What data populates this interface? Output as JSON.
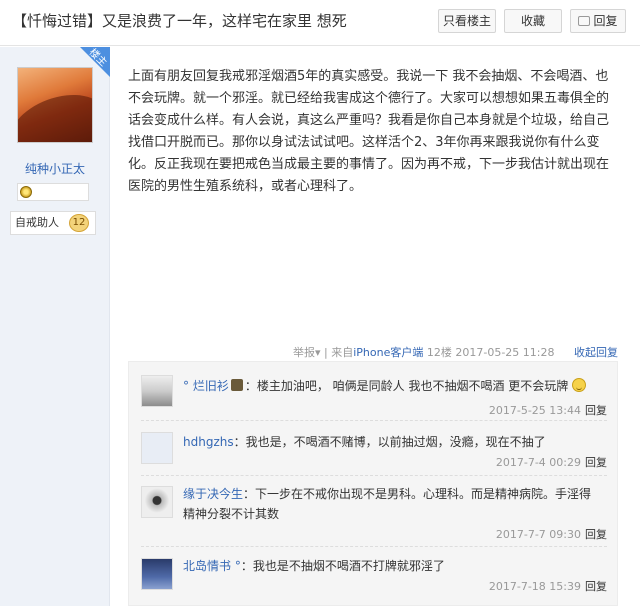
{
  "header": {
    "title": "【忏悔过错】又是浪费了一年，这样宅在家里 想死",
    "buttons": {
      "only_lz": "只看楼主",
      "favorite": "收藏",
      "reply": "回复"
    }
  },
  "author": {
    "corner_label": "楼主",
    "username": "纯种小正太",
    "badge_label": "自戒助人",
    "badge_count": "12"
  },
  "post": {
    "body": "上面有朋友回复我戒邪淫烟酒5年的真实感受。我说一下 我不会抽烟、不会喝酒、也不会玩牌。就一个邪淫。就已经给我害成这个德行了。大家可以想想如果五毒俱全的话会变成什么样。有人会说，真这么严重吗？我看是你自己本身就是个垃圾，给自己找借口开脱而已。那你以身试法试试吧。这样活个2、3年你再来跟我说你有什么变化。反正我现在要把戒色当成最主要的事情了。因为再不戒，下一步我估计就出现在医院的男性生殖系统科，或者心理科了。",
    "meta": {
      "report": "举报▾",
      "divider": "|",
      "source_prefix": "来自",
      "source": "iPhone客户端",
      "floor": "12楼",
      "time": "2017-05-25 11:28",
      "collapse": "收起回复"
    }
  },
  "replies": [
    {
      "name": "° 烂旧衫",
      "text": "：楼主加油吧， 咱俩是同龄人 我也不抽烟不喝酒 更不会玩牌",
      "time": "2017-5-25 13:44",
      "action": "回复"
    },
    {
      "name": "hdhgzhs",
      "text": "：我也是，不喝酒不赌博，以前抽过烟，没瘾，现在不抽了",
      "time": "2017-7-4 00:29",
      "action": "回复"
    },
    {
      "name": "缘于决今生",
      "text": "：下一步在不戒你出现不是男科。心理科。而是精神病院。手淫得精神分裂不计其数",
      "time": "2017-7-7 09:30",
      "action": "回复"
    },
    {
      "name": "北岛情书 °",
      "text": "：我也是不抽烟不喝酒不打牌就邪淫了",
      "time": "2017-7-18 15:39",
      "action": "回复"
    }
  ]
}
